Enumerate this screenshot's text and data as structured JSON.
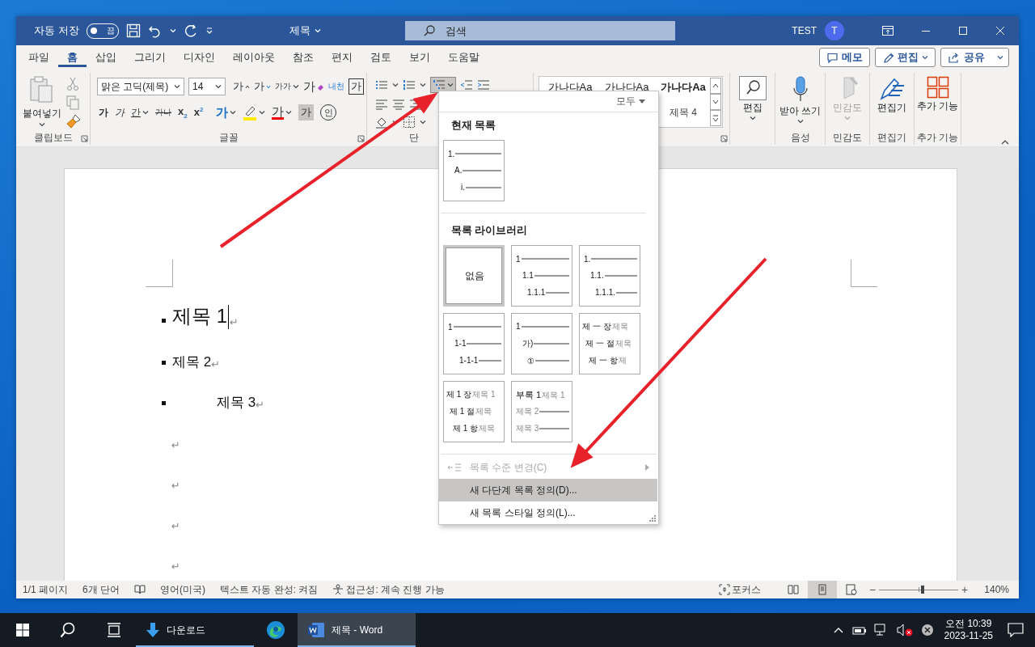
{
  "title_bar": {
    "autosave_label": "자동 저장",
    "autosave": {
      "on": false,
      "label": "끔"
    },
    "doc_title": "제목",
    "search_placeholder": "검색",
    "user": "TEST",
    "avatar": "T"
  },
  "menu_tabs": [
    {
      "label": "파일",
      "selected": false
    },
    {
      "label": "홈",
      "selected": true
    },
    {
      "label": "삽입",
      "selected": false
    },
    {
      "label": "그리기",
      "selected": false
    },
    {
      "label": "디자인",
      "selected": false
    },
    {
      "label": "레이아웃",
      "selected": false
    },
    {
      "label": "참조",
      "selected": false
    },
    {
      "label": "편지",
      "selected": false
    },
    {
      "label": "검토",
      "selected": false
    },
    {
      "label": "보기",
      "selected": false
    },
    {
      "label": "도움말",
      "selected": false
    }
  ],
  "tab_actions": [
    {
      "label": "메모",
      "kind": "comment"
    },
    {
      "label": "편집",
      "kind": "edit"
    },
    {
      "label": "공유",
      "kind": "share"
    }
  ],
  "clipboard": {
    "paste": "붙여넣기",
    "label": "클립보드"
  },
  "font": {
    "name": "맑은 고딕(제목)",
    "size_field": "14",
    "label": "글꼴",
    "row1": [
      {
        "kind": "grow",
        "label": "가"
      },
      {
        "kind": "shrink",
        "label": "가"
      },
      {
        "kind": "case",
        "label": "가가"
      },
      {
        "kind": "clear",
        "label": "가"
      },
      {
        "kind": "phonetic",
        "label": "내천"
      },
      {
        "kind": "boxed",
        "label": "가"
      }
    ],
    "row2": [
      {
        "kind": "bold",
        "label": "가"
      },
      {
        "kind": "italic",
        "label": "가"
      },
      {
        "kind": "underline",
        "label": "간"
      },
      {
        "kind": "strike",
        "label": "가나"
      },
      {
        "kind": "sub",
        "label": "x$_{2}$"
      },
      {
        "kind": "sup",
        "label": "x$^{2}$"
      },
      {
        "kind": "effect",
        "label": "가"
      },
      {
        "kind": "highlight"
      },
      {
        "kind": "color",
        "label": "가"
      },
      {
        "kind": "shade",
        "label": "가"
      },
      {
        "kind": "circle",
        "label": "인"
      }
    ]
  },
  "paragraph": {
    "label": "단",
    "multilevel_pressed": true
  },
  "styles": {
    "previews": [
      "가나다Aa",
      "가나다Aa",
      "가나다Aa"
    ],
    "caption": "제목 4"
  },
  "right_groups": [
    {
      "kind": "find",
      "button": "편집"
    },
    {
      "kind": "dictate",
      "button": "받아 쓰기",
      "label": "음성"
    },
    {
      "kind": "sensitivity",
      "button": "민감도",
      "label": "민감도",
      "disabled": true
    },
    {
      "kind": "editor",
      "button": "편집기",
      "label": "편집기"
    },
    {
      "kind": "addins",
      "button": "추가 기능",
      "label": "추가 기능"
    }
  ],
  "document": {
    "paragraphs": [
      {
        "kind": "h1",
        "text": "제목 1",
        "mark": "↵",
        "cursor": true
      },
      {
        "kind": "h2",
        "text": "제목 2",
        "mark": "↵"
      },
      {
        "kind": "h3",
        "text": "제목 3",
        "mark": "↵"
      },
      {
        "kind": "empty",
        "mark": "↵"
      },
      {
        "kind": "empty",
        "mark": "↵"
      },
      {
        "kind": "empty",
        "mark": "↵"
      },
      {
        "kind": "empty",
        "mark": "↵"
      }
    ]
  },
  "list_menu": {
    "filter": "모두",
    "current_title": "현재 목록",
    "current": [
      {
        "num": "1."
      },
      {
        "num": "A."
      },
      {
        "num": "i."
      }
    ],
    "library_title": "목록 라이브러리",
    "library": [
      {
        "kind": "none",
        "label": "없음",
        "selected": true
      },
      {
        "kind": "levels",
        "selected": false,
        "rows": [
          {
            "num": "1"
          },
          {
            "num": "1.1"
          },
          {
            "num": "1.1.1"
          }
        ]
      },
      {
        "kind": "levels",
        "selected": false,
        "rows": [
          {
            "num": "1."
          },
          {
            "num": "1.1."
          },
          {
            "num": "1.1.1."
          }
        ]
      },
      {
        "kind": "levels",
        "selected": false,
        "rows": [
          {
            "num": "1"
          },
          {
            "num": "1-1"
          },
          {
            "num": "1-1-1"
          }
        ]
      },
      {
        "kind": "levels",
        "selected": false,
        "rows": [
          {
            "num": "1"
          },
          {
            "num": "가)"
          },
          {
            "num": "①"
          }
        ]
      },
      {
        "kind": "captions",
        "selected": false,
        "rows": [
          {
            "num": "제 一 장",
            "caption": "제목"
          },
          {
            "num": "제 一 절",
            "caption": "제목"
          },
          {
            "num": "제 一 항",
            "caption": "제"
          }
        ]
      },
      {
        "kind": "captions",
        "selected": false,
        "rows": [
          {
            "num": "제 1 장",
            "caption": "제목 1"
          },
          {
            "num": "제 1 절",
            "caption": "제목"
          },
          {
            "num": "제 1 항",
            "caption": "제목"
          }
        ]
      },
      {
        "kind": "appendix",
        "selected": false,
        "rows": [
          {
            "num": "부록 1",
            "caption": "제목 1"
          },
          {
            "caption": "제목 2"
          },
          {
            "caption": "제목 3"
          }
        ]
      }
    ],
    "items": [
      {
        "label": "목록 수준 변경(C)",
        "disabled": true,
        "submenu": true,
        "selected": false
      },
      {
        "label": "새 다단계 목록 정의(D)...",
        "disabled": false,
        "selected": true
      },
      {
        "label": "새 목록 스타일 정의(L)...",
        "disabled": false,
        "selected": false
      }
    ]
  },
  "status_bar": {
    "left": [
      {
        "kind": "text",
        "label": "1/1 페이지"
      },
      {
        "kind": "text",
        "label": "6개 단어"
      },
      {
        "kind": "proof"
      },
      {
        "kind": "text",
        "label": "영어(미국)"
      },
      {
        "kind": "text",
        "label": "텍스트 자동 완성: 켜짐"
      },
      {
        "kind": "access",
        "label": "접근성: 계속 진행 가능"
      }
    ],
    "focus": "포커스",
    "views": [
      {
        "kind": "read",
        "selected": false
      },
      {
        "kind": "print",
        "selected": true
      },
      {
        "kind": "web",
        "selected": false
      }
    ],
    "zoom": {
      "minus": "−",
      "plus": "+",
      "level": 0.55,
      "reading": "140%"
    }
  },
  "taskbar": {
    "apps": [
      {
        "kind": "download",
        "label": "다운로드",
        "selected": false,
        "running": true
      },
      {
        "kind": "edge",
        "selected": false,
        "running": false
      },
      {
        "kind": "word",
        "label": "제목 - Word",
        "selected": true,
        "running": true
      }
    ],
    "tray": {
      "ampm": "오전 10:39",
      "date": "2023-11-25"
    }
  }
}
